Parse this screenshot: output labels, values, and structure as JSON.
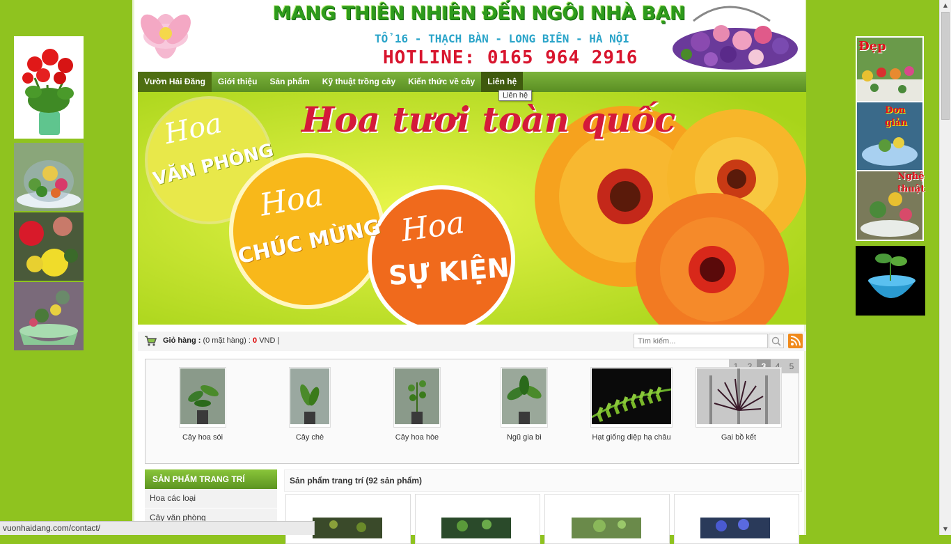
{
  "header": {
    "slogan": "MANG THIÊN NHIÊN ĐẾN NGÔI NHÀ BẠN",
    "address": "TỔ 16 - THẠCH BÀN - LONG BIÊN - HÀ NỘI",
    "hotline": "HOTLINE: 0165 964 2916"
  },
  "nav": {
    "items": [
      "Vườn Hải Đăng",
      "Giới thiệu",
      "Sản phẩm",
      "Kỹ thuật trồng cây",
      "Kiến thức về cây",
      "Liên hệ"
    ],
    "tooltip": "Liên hệ"
  },
  "banner": {
    "headline": "Hoa tươi toàn quốc",
    "circle1_top": "Hoa",
    "circle1_bottom": "VĂN PHÒNG",
    "circle2_top": "Hoa",
    "circle2_bottom": "CHÚC MỪNG",
    "circle3_top": "Hoa",
    "circle3_bottom": "SỰ KIỆN"
  },
  "cart": {
    "label": "Giỏ hàng :",
    "count": "(0 mặt hàng) :",
    "amount": "0",
    "currency": "VND |"
  },
  "search": {
    "placeholder": "Tìm kiếm..."
  },
  "carousel": {
    "pages": [
      "1",
      "2",
      "3",
      "4",
      "5"
    ],
    "current_page": "3",
    "items": [
      "Cây hoa sói",
      "Cây chè",
      "Cây hoa hòe",
      "Ngũ gia bì",
      "Hạt giống diệp hạ châu",
      "Gai bồ kết"
    ]
  },
  "sidebar": {
    "title": "SẢN PHẨM TRANG TRÍ",
    "items": [
      "Hoa các loại",
      "Cây văn phòng"
    ]
  },
  "products": {
    "title": "Sản phẩm trang trí (92 sản phẩm)"
  },
  "right_ads": {
    "ad1": "Đẹp",
    "ad2_line1": "Đơn",
    "ad2_line2": "giản",
    "ad3_line1": "Nghệ",
    "ad3_line2": "thuật"
  },
  "status_url": "vuonhaidang.com/contact/",
  "colors": {
    "page_bg": "#8fc31f",
    "nav_green": "#6aa22f",
    "slogan_green": "#2e9b1c",
    "hotline_red": "#d8152e",
    "address_blue": "#2aa4c9"
  }
}
